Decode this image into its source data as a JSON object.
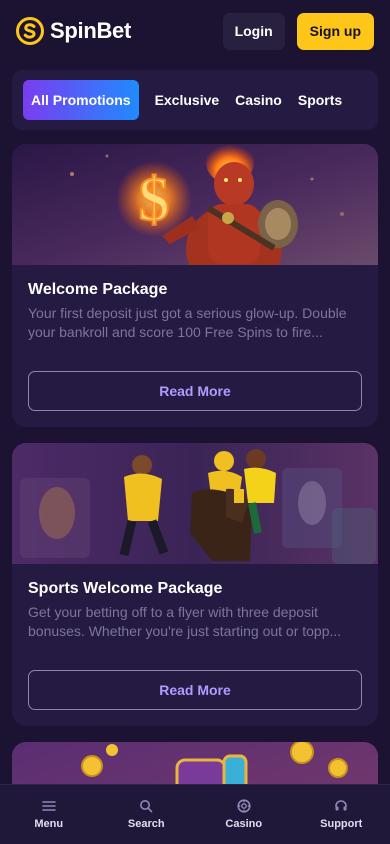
{
  "brand": {
    "name": "SpinBet",
    "accent": "#ffc61a"
  },
  "header": {
    "login_label": "Login",
    "signup_label": "Sign up"
  },
  "tabs": [
    {
      "label": "All Promotions",
      "active": true
    },
    {
      "label": "Exclusive"
    },
    {
      "label": "Casino"
    },
    {
      "label": "Sports"
    }
  ],
  "promotions": [
    {
      "title": "Welcome Package",
      "description": "Your first deposit just got a serious glow-up. Double your bankroll and score 100 Free Spins to fire...",
      "cta": "Read More",
      "image_icon": "fire-demon-illustration"
    },
    {
      "title": "Sports Welcome Package",
      "description": "Get your betting off to a flyer with three deposit bonuses. Whether you're just starting out or topp...",
      "cta": "Read More",
      "image_icon": "athletes-illustration"
    },
    {
      "image_icon": "slot-coins-illustration"
    }
  ],
  "bottom_nav": [
    {
      "label": "Menu",
      "icon": "menu-icon"
    },
    {
      "label": "Search",
      "icon": "search-icon"
    },
    {
      "label": "Casino",
      "icon": "casino-chip-icon"
    },
    {
      "label": "Support",
      "icon": "headset-icon"
    }
  ]
}
